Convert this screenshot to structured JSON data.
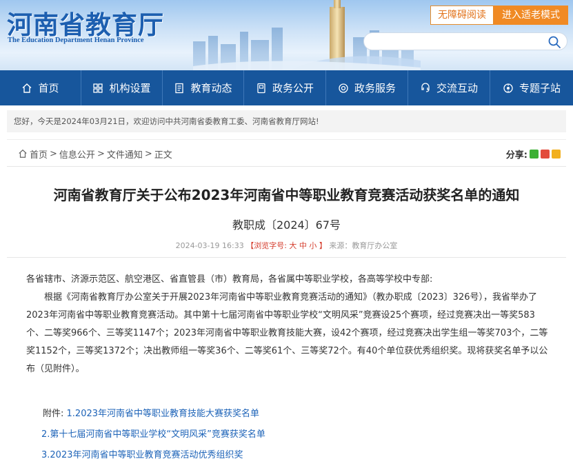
{
  "header": {
    "title": "河南省教育厅",
    "subtitle": "The Education Department Henan Province",
    "accessibility_label": "无障碍阅读",
    "elder_mode_label": "进入适老模式",
    "search_placeholder": ""
  },
  "nav": {
    "items": [
      {
        "label": "首页",
        "icon": "home-icon"
      },
      {
        "label": "机构设置",
        "icon": "grid-icon"
      },
      {
        "label": "教育动态",
        "icon": "document-icon"
      },
      {
        "label": "政务公开",
        "icon": "notebook-icon"
      },
      {
        "label": "政务服务",
        "icon": "service-icon"
      },
      {
        "label": "交流互动",
        "icon": "interaction-icon"
      },
      {
        "label": "专题子站",
        "icon": "topic-icon"
      }
    ]
  },
  "welcome": {
    "text": "您好，今天是2024年03月21日，欢迎访问中共河南省委教育工委、河南省教育厅网站!"
  },
  "breadcrumb": {
    "items": [
      "首页",
      "信息公开",
      "文件通知",
      "正文"
    ],
    "separator": ">"
  },
  "share": {
    "label": "分享:",
    "icons": [
      "wechat-share-icon",
      "weibo-share-icon",
      "qzone-share-icon"
    ]
  },
  "article": {
    "title": "河南省教育厅关于公布2023年河南省中等职业教育竞赛活动获奖名单的通知",
    "doc_number": "教职成〔2024〕67号",
    "date": "2024-03-19 16:33",
    "font_size_prefix": "【浏览字号:",
    "font_large": "大",
    "font_medium": "中",
    "font_small": "小",
    "font_size_suffix": "】",
    "source": "来源：教育厅办公室",
    "salutation": "各省辖市、济源示范区、航空港区、省直管县（市）教育局，各省属中等职业学校，各高等学校中专部:",
    "paragraph": "根据《河南省教育厅办公室关于开展2023年河南省中等职业教育竞赛活动的通知》（教办职成〔2023〕326号），我省举办了2023年河南省中等职业教育竞赛活动。其中第十七届河南省中等职业学校“文明风采”竞赛设25个赛项，经过竞赛决出一等奖583个、二等奖966个、三等奖1147个；2023年河南省中等职业教育技能大赛，设42个赛项，经过竞赛决出学生组一等奖703个，二等奖1152个，三等奖1372个；决出教师组一等奖36个、二等奖61个、三等奖72个。有40个单位获优秀组织奖。现将获奖名单予以公布（见附件）。"
  },
  "attachments": {
    "label": "附件:",
    "items": [
      "1.2023年河南省中等职业教育技能大赛获奖名单",
      "2.第十七届河南省中等职业学校“文明风采”竞赛获奖名单",
      "3.2023年河南省中等职业教育竞赛活动优秀组织奖"
    ]
  },
  "colors": {
    "nav_bg": "#17569c",
    "brand_blue": "#1d5fb0",
    "accent_orange": "#f08a24",
    "link_blue": "#1d63b8",
    "highlight_red": "#d43a2a"
  }
}
